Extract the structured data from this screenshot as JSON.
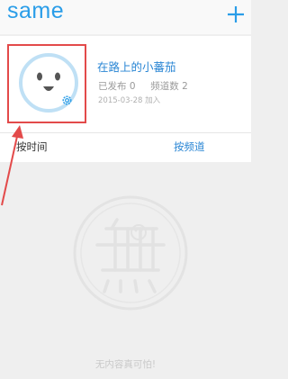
{
  "app": {
    "logo": "same"
  },
  "profile": {
    "username": "在路上的小蕃茄",
    "published_label": "已发布",
    "published_count": "0",
    "channels_label": "频道数",
    "channels_count": "2",
    "joined": "2015-03-28 加入"
  },
  "tabs": [
    {
      "label": "按时间"
    },
    {
      "label": "按频道"
    }
  ],
  "empty_state": {
    "text": "无内容真可怕!"
  },
  "colors": {
    "accent": "#2a9de8",
    "highlight": "#e34a4a"
  },
  "icons": [
    "plus-icon",
    "avatar-face-icon",
    "gear-icon",
    "arrow-annotation",
    "empty-watermark-icon"
  ]
}
